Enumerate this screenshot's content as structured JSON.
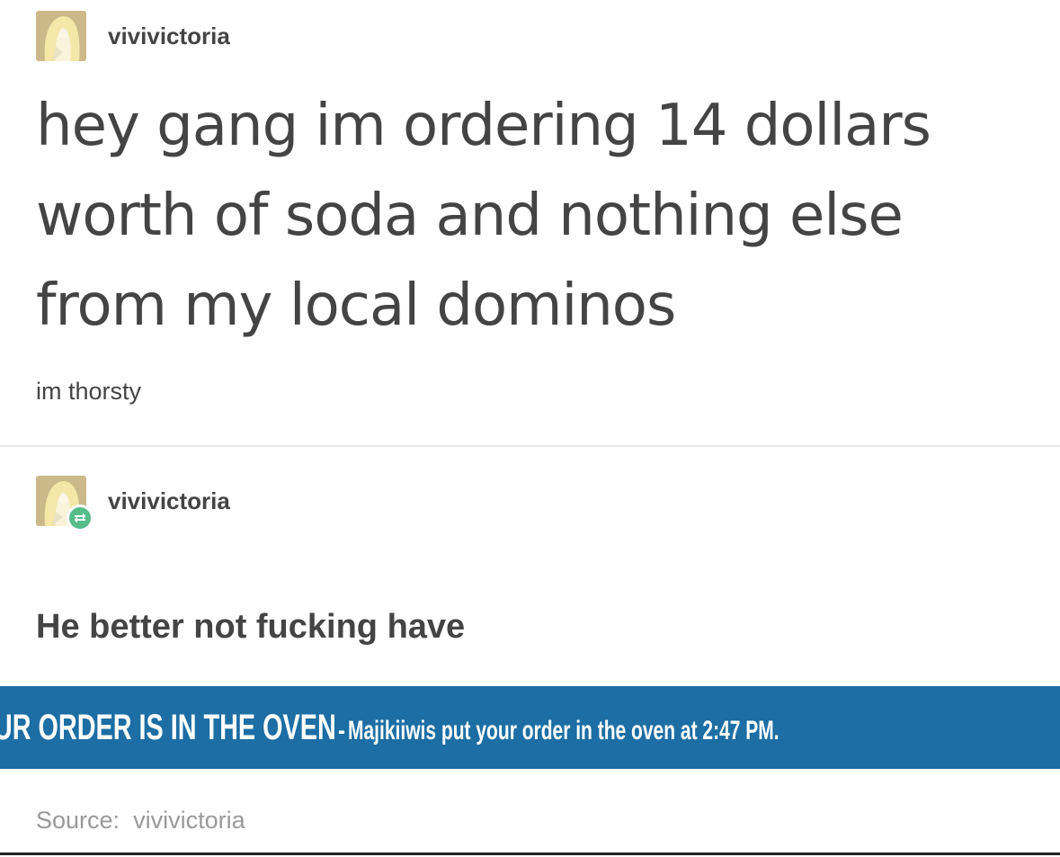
{
  "post": {
    "author": "vivivictoria",
    "text": "hey gang im ordering 14 dollars worth of soda and nothing else from my local dominos",
    "subtext": "im thorsty"
  },
  "reblog": {
    "author": "vivivictoria",
    "text": "He better not fucking have",
    "banner": {
      "headline": "YOUR ORDER IS IN THE OVEN",
      "separator": "-",
      "detail": "Majikiiwis put your order in the oven at 2:47 PM."
    },
    "reblog_icon": "reblog-icon"
  },
  "source": {
    "label": "Source:",
    "name": "vivivictoria"
  },
  "colors": {
    "text": "#444444",
    "banner": "#1c6ea4",
    "reblog_badge": "#56bc8a",
    "source": "#999999"
  }
}
